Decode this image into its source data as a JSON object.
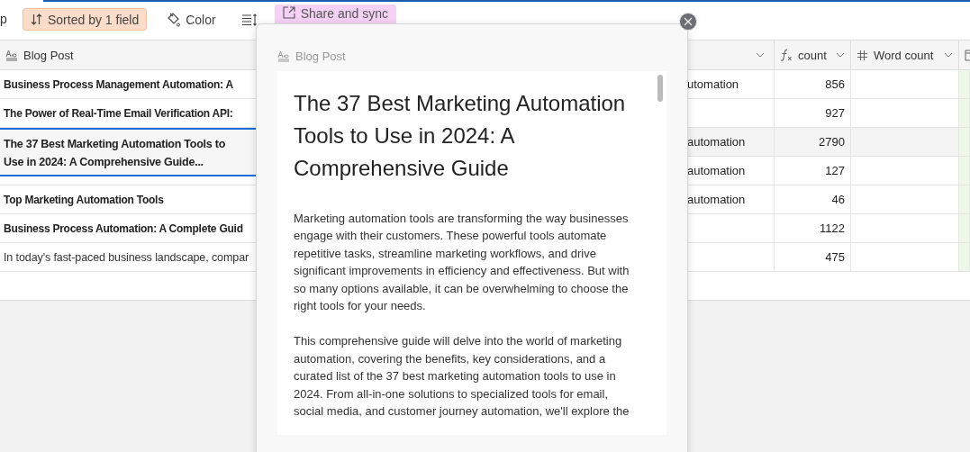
{
  "toolbar": {
    "items": [
      {
        "kind": "text",
        "label": "p"
      },
      {
        "kind": "sort",
        "label": "Sorted by 1 field"
      },
      {
        "kind": "color",
        "label": "Color"
      },
      {
        "kind": "row_height"
      },
      {
        "kind": "share",
        "label": "Share and sync"
      }
    ]
  },
  "table": {
    "columns": [
      {
        "kind": "text",
        "label": "Blog Post"
      },
      {
        "kind": "covered"
      },
      {
        "kind": "formula",
        "label": "count"
      },
      {
        "kind": "number",
        "label": "Word count"
      },
      {
        "kind": "date"
      }
    ],
    "rows": [
      {
        "kind": "heading",
        "title": "Business Process Management Automation: A",
        "column_2": "utomation",
        "count": "856",
        "selected": false
      },
      {
        "kind": "heading",
        "title": "The Power of Real-Time Email Verification API:",
        "count": "927",
        "selected": false
      },
      {
        "kind": "heading",
        "title": "The 37 Best Marketing Automation Tools to Use in 2024: A Comprehensive Guide...",
        "column_2": "automation",
        "count": "2790",
        "selected": true
      },
      {
        "kind": "heading",
        "column_2": "automation",
        "count": "127",
        "selected": false
      },
      {
        "kind": "heading",
        "title": "Top Marketing Automation Tools",
        "column_2": "automation",
        "count": "46",
        "selected": false
      },
      {
        "kind": "heading",
        "title": "Business Process Automation: A Complete Guid",
        "count": "1122",
        "selected": false
      },
      {
        "kind": "paragraph",
        "title": "In today's fast-paced business landscape, compar",
        "count": "475",
        "selected": false
      }
    ]
  },
  "record_modal": {
    "field_label": "Blog Post",
    "title": "The 37 Best Marketing Automation Tools to Use in 2024: A Comprehensive Guide",
    "paragraphs": [
      "Marketing automation tools are transforming the way businesses engage with their customers. These powerful tools automate repetitive tasks, streamline marketing workflows, and drive significant improvements in efficiency and effectiveness. But with so many options available, it can be overwhelming to choose the right tools for your needs.",
      "This comprehensive guide will delve into the world of marketing automation, covering the benefits, key considerations, and a curated list of the 37 best marketing automation tools to use in 2024. From all-in-one solutions to specialized tools for email, social media, and customer journey automation, we'll explore the"
    ]
  }
}
